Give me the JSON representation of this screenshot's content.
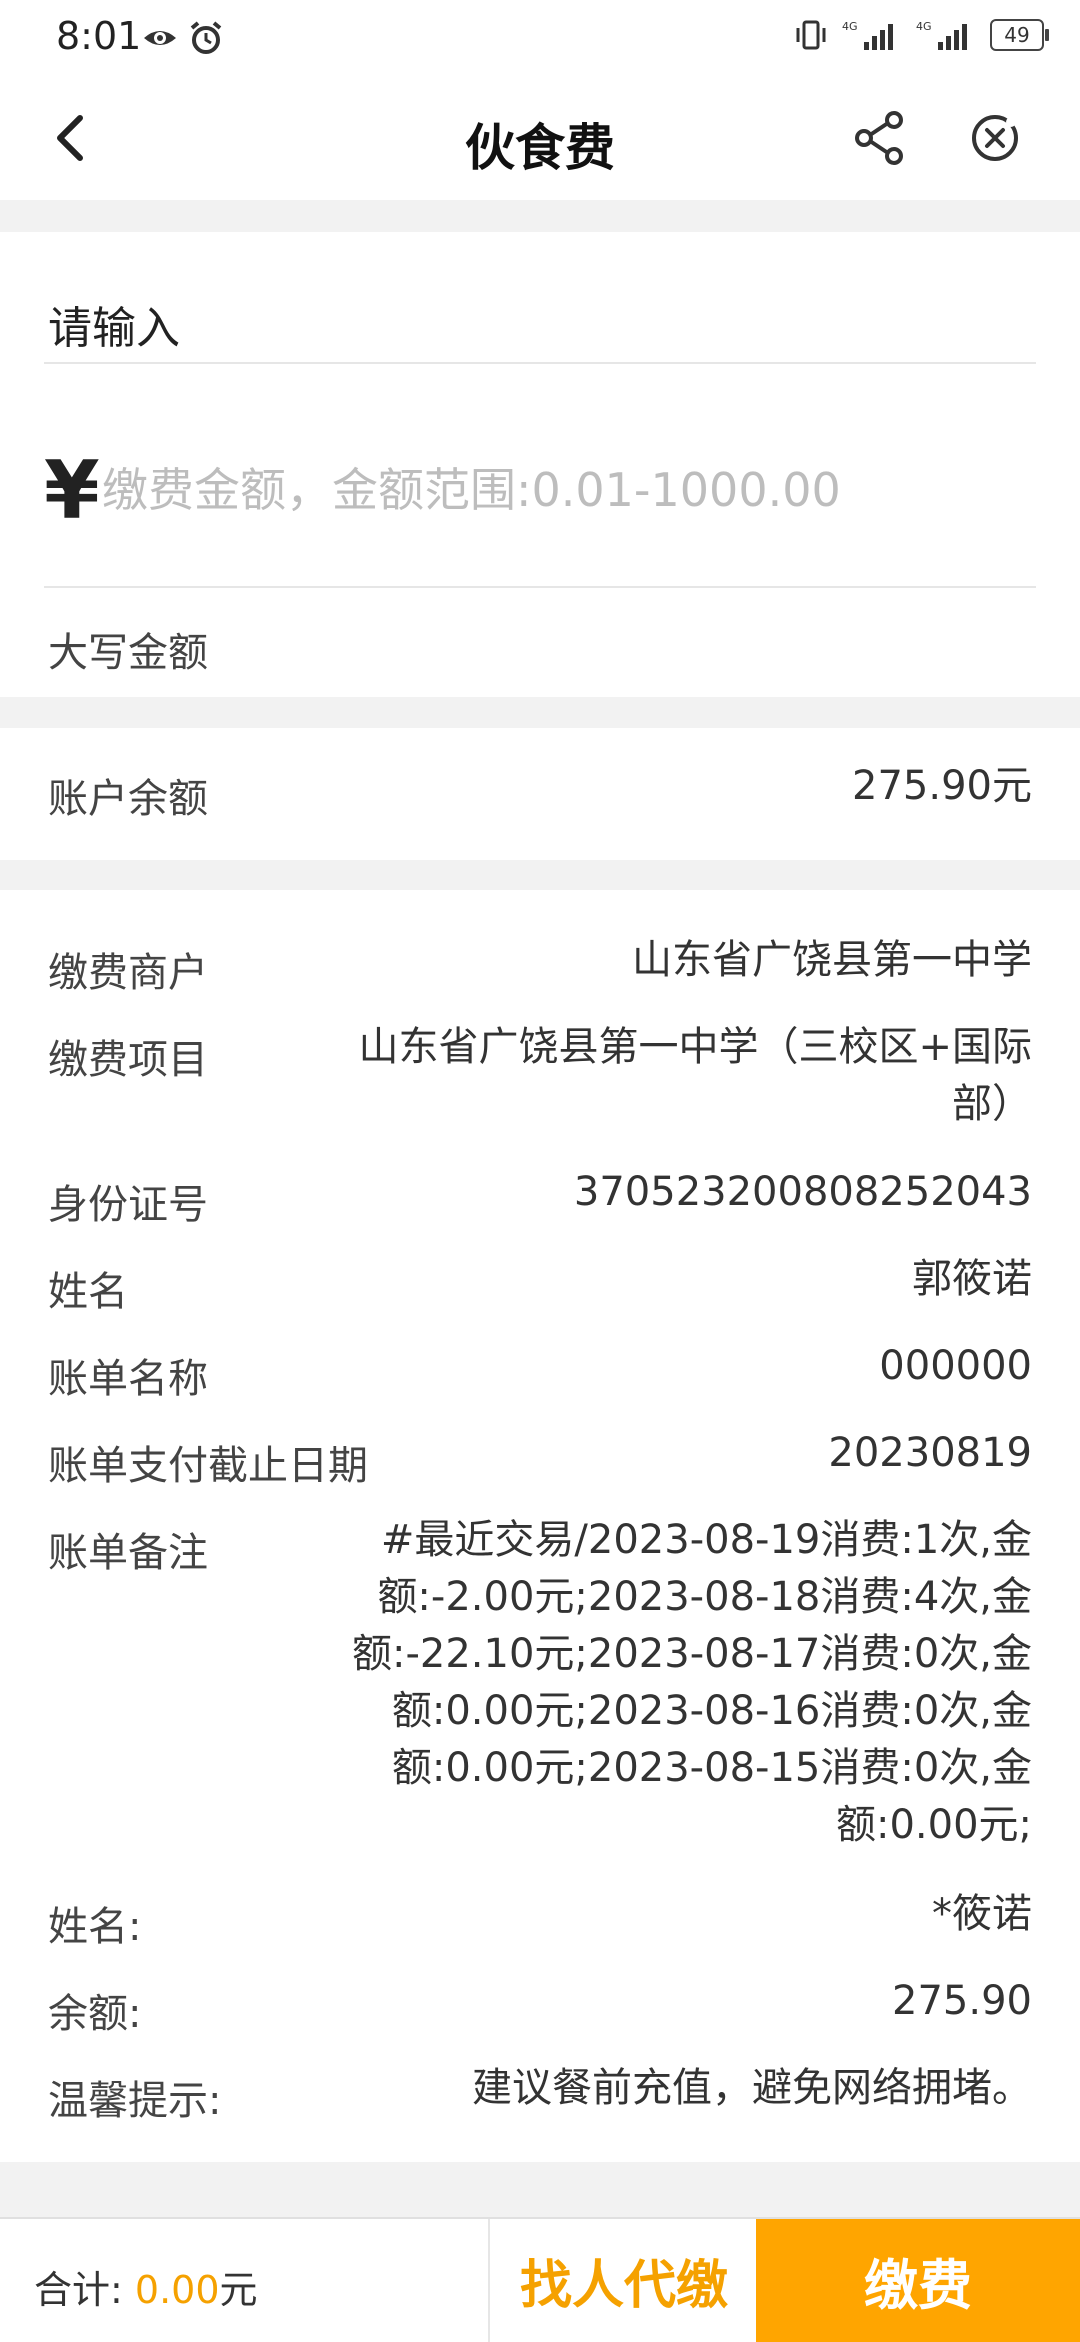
{
  "status": {
    "time": "8:01",
    "battery": "49",
    "net1": "4G",
    "net2": "4G"
  },
  "nav": {
    "title": "伙食费"
  },
  "input_section": {
    "title": "请输入",
    "currency_symbol": "¥",
    "amount_placeholder": "缴费金额，金额范围:0.01-1000.00",
    "capital_label": "大写金额"
  },
  "balance": {
    "label": "账户余额",
    "value": "275.90元"
  },
  "details": [
    {
      "label": "缴费商户",
      "value": "山东省广饶县第一中学"
    },
    {
      "label": "缴费项目",
      "value": "山东省广饶县第一中学（三校区+国际部）"
    },
    {
      "label": "身份证号",
      "value": "370523200808252043"
    },
    {
      "label": "姓名",
      "value": "郭筱诺"
    },
    {
      "label": "账单名称",
      "value": "000000"
    },
    {
      "label": "账单支付截止日期",
      "value": "20230819"
    },
    {
      "label": "账单备注",
      "value": "#最近交易/2023-08-19消费:1次,金额:-2.00元;2023-08-18消费:4次,金额:-22.10元;2023-08-17消费:0次,金额:0.00元;2023-08-16消费:0次,金额:0.00元;2023-08-15消费:0次,金额:0.00元;"
    },
    {
      "label": "姓名:",
      "value": "*筱诺"
    },
    {
      "label": "余额:",
      "value": "275.90"
    },
    {
      "label": "温馨提示:",
      "value": "建议餐前充值，避免网络拥堵。"
    }
  ],
  "bottom": {
    "total_label": "合计:",
    "total_value": "0.00",
    "total_unit": "元",
    "proxy_label": "找人代缴",
    "pay_label": "缴费"
  },
  "colors": {
    "accent": "#ffa500",
    "accent_text": "#f5a100"
  },
  "icons": [
    "back-icon",
    "share-icon",
    "close-icon",
    "eye-icon",
    "alarm-icon",
    "vibrate-icon",
    "signal-icon",
    "battery-icon"
  ]
}
